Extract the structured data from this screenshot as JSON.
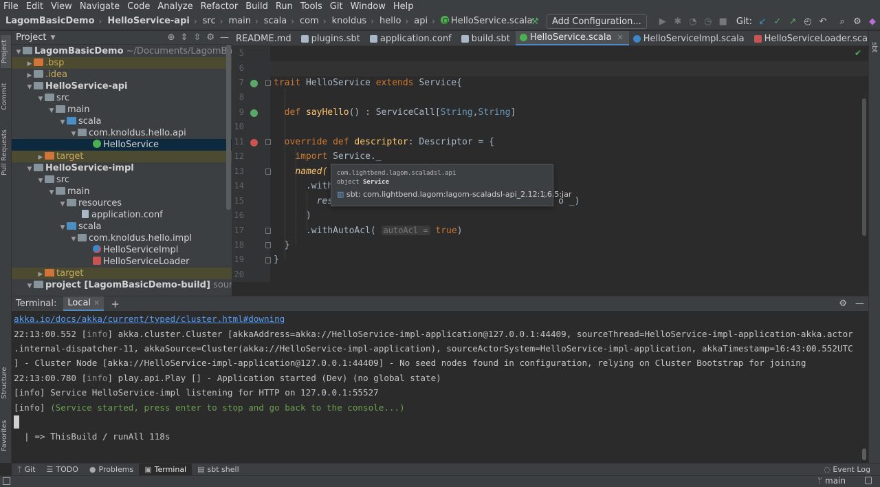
{
  "menu": [
    "File",
    "Edit",
    "View",
    "Navigate",
    "Code",
    "Analyze",
    "Refactor",
    "Build",
    "Run",
    "Tools",
    "Git",
    "Window",
    "Help"
  ],
  "breadcrumb": [
    "LagomBasicDemo",
    "HelloService-api",
    "src",
    "main",
    "scala",
    "com",
    "knoldus",
    "hello",
    "api",
    "HelloService.scala"
  ],
  "toolbar": {
    "add_config": "Add Configuration...",
    "git_label": "Git:"
  },
  "left_strip": [
    "Project",
    "Commit",
    "Pull Requests",
    "Structure",
    "Favorites"
  ],
  "right_strip": "sbt",
  "project_panel": {
    "title": "Project",
    "tree": [
      {
        "label": "LagomBasicDemo",
        "suffix": "~/Documents/LagomBasicDem",
        "kind": "module"
      },
      {
        "label": ".bsp",
        "kind": "folder-orange"
      },
      {
        "label": ".idea",
        "kind": "folder"
      },
      {
        "label": "HelloService-api",
        "kind": "module"
      },
      {
        "label": "src",
        "kind": "folder"
      },
      {
        "label": "main",
        "kind": "folder"
      },
      {
        "label": "scala",
        "kind": "folder-src"
      },
      {
        "label": "com.knoldus.hello.api",
        "kind": "package"
      },
      {
        "label": "HelloService",
        "kind": "trait",
        "selected": true
      },
      {
        "label": "target",
        "kind": "folder-orange"
      },
      {
        "label": "HelloService-impl",
        "kind": "module"
      },
      {
        "label": "src",
        "kind": "folder"
      },
      {
        "label": "main",
        "kind": "folder"
      },
      {
        "label": "resources",
        "kind": "folder-res"
      },
      {
        "label": "application.conf",
        "kind": "file"
      },
      {
        "label": "scala",
        "kind": "folder-src"
      },
      {
        "label": "com.knoldus.hello.impl",
        "kind": "package"
      },
      {
        "label": "HelloServiceImpl",
        "kind": "class"
      },
      {
        "label": "HelloServiceLoader",
        "kind": "class-red"
      },
      {
        "label": "target",
        "kind": "folder-orange"
      },
      {
        "label": "project [LagomBasicDemo-build]",
        "suffix": "sources roo",
        "kind": "module"
      }
    ]
  },
  "tabs": [
    {
      "label": "README.md",
      "color": "#6a8759"
    },
    {
      "label": "plugins.sbt",
      "color": "#a9b7c6"
    },
    {
      "label": "application.conf",
      "color": "#a9b7c6"
    },
    {
      "label": "build.sbt",
      "color": "#a9b7c6"
    },
    {
      "label": "HelloService.scala",
      "color": "#4caf50",
      "active": true
    },
    {
      "label": "HelloServiceImpl.scala",
      "color": "#3e86c6"
    },
    {
      "label": "HelloServiceLoader.scala",
      "color": "#c75450"
    }
  ],
  "editor": {
    "line_numbers": [
      "5",
      "6",
      "7",
      "8",
      "9",
      "10",
      "11",
      "12",
      "13",
      "14",
      "15",
      "16",
      "17",
      "18",
      "19",
      "20"
    ],
    "lines": {
      "l7": {
        "kw": "trait",
        "name": "HelloService",
        "ext": "extends",
        "parent": "Service{"
      },
      "l9": {
        "kw": "def",
        "fn": "sayHello",
        "sig": "() : ServiceCall[",
        "g1": "String",
        "comma": ",",
        "g2": "String",
        "end": "]"
      },
      "l11": {
        "kw1": "override",
        "kw2": "def",
        "fn": "descriptor",
        "rest": ": Descriptor = {"
      },
      "l12": {
        "kw": "import",
        "rest": "Service._"
      },
      "l13": {
        "text": "named("
      },
      "l14": {
        "text": ".with"
      },
      "l15": {
        "text": "res",
        "tail": "o _)"
      },
      "l16": {
        "text": ")"
      },
      "l17": {
        "text": ".withAutoAcl(",
        "hint": "autoAcl =",
        "val": "true",
        "end": ")"
      },
      "l18": {
        "text": "}"
      },
      "l19": {
        "text": "}"
      }
    }
  },
  "tooltip": {
    "package": "com.lightbend.lagom.scaladsl.api",
    "kind": "object",
    "name": "Service",
    "source": "sbt: com.lightbend.lagom:lagom-scaladsl-api_2.12:1.6.5:jar"
  },
  "terminal": {
    "label": "Terminal:",
    "tab": "Local",
    "link": "akka.io/docs/akka/current/typed/cluster.html#downing",
    "l1_time": "22:13:00.552 [",
    "l1_info": "info",
    "l1_rest": "] akka.cluster.Cluster [akkaAddress=akka://HelloService-impl-application@127.0.0.1:44409, sourceThread=HelloService-impl-application-akka.actor",
    "l2": ".internal-dispatcher-11, akkaSource=Cluster(akka://HelloService-impl-application), sourceActorSystem=HelloService-impl-application, akkaTimestamp=16:43:00.552UTC",
    "l3": "] - Cluster Node [akka://HelloService-impl-application@127.0.0.1:44409] - No seed nodes found in configuration, relying on Cluster Bootstrap for joining",
    "l4_time": "22:13:00.780 [",
    "l4_info": "info",
    "l4_rest": "] play.api.Play [] - Application started (Dev) (no global state)",
    "l5": "[info] Service HelloService-impl listening for HTTP on 127.0.0.1:55527",
    "l6_prefix": "[info] ",
    "l6_green": "(Service started, press enter to stop and go back to the console...)",
    "l7": "  | => ThisBuild / runAll 118s"
  },
  "bottom_tabs": [
    "Git",
    "TODO",
    "Problems",
    "Terminal",
    "sbt shell"
  ],
  "event_log": "Event Log",
  "branch": "main"
}
